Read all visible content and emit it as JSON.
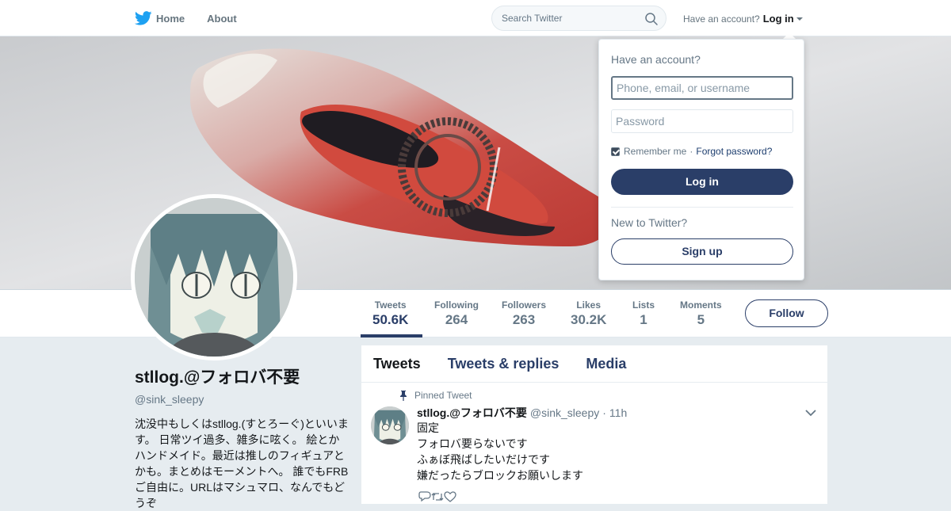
{
  "nav": {
    "home_label": "Home",
    "about_label": "About",
    "search_placeholder": "Search Twitter",
    "account_prompt": "Have an account?",
    "login_label": "Log in"
  },
  "profile": {
    "name": "stllog.@フォロバ不要",
    "handle": "@sink_sleepy",
    "bio": "沈没中もしくはstllog.(すとろーぐ)といいます。 日常ツイ過多、雑多に呟く。 絵とかハンドメイド。最近は推しのフィギュアとかも。まとめはモーメントへ。 誰でもFRBご自由に。URLはマシュマロ、なんでもどうぞ"
  },
  "stats": [
    {
      "label": "Tweets",
      "value": "50.6K"
    },
    {
      "label": "Following",
      "value": "264"
    },
    {
      "label": "Followers",
      "value": "263"
    },
    {
      "label": "Likes",
      "value": "30.2K"
    },
    {
      "label": "Lists",
      "value": "1"
    },
    {
      "label": "Moments",
      "value": "5"
    }
  ],
  "follow_label": "Follow",
  "timeline": {
    "tabs": [
      "Tweets",
      "Tweets & replies",
      "Media"
    ],
    "pinned_label": "Pinned Tweet",
    "tweet": {
      "name": "stllog.@フォロバ不要",
      "handle": "@sink_sleepy",
      "separator": "·",
      "time": "11h",
      "lines": [
        "固定",
        "フォロバ要らないです",
        "ふぁぼ飛ばしたいだけです",
        "嫌だったらブロックお願いします"
      ]
    }
  },
  "login_dropdown": {
    "title": "Have an account?",
    "username_placeholder": "Phone, email, or username",
    "password_placeholder": "Password",
    "remember_label": "Remember me",
    "separator": "·",
    "forgot_label": "Forgot password?",
    "login_button": "Log in",
    "new_prompt": "New to Twitter?",
    "signup_button": "Sign up"
  },
  "colors": {
    "accent": "#2a3e68",
    "twitter_blue": "#1da1f2",
    "background": "#e6ecf0"
  }
}
